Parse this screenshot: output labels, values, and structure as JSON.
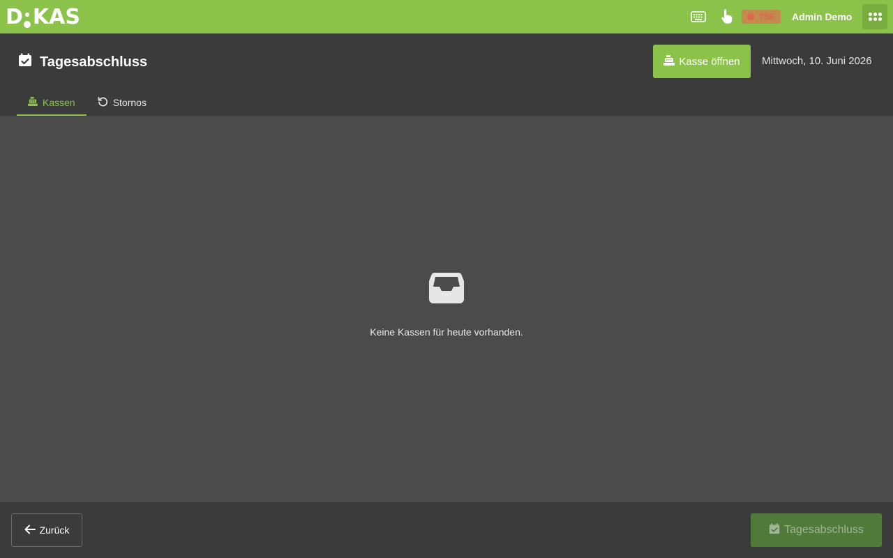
{
  "app": {
    "logo_text_1": "D",
    "logo_text_2": "KAS"
  },
  "topbar": {
    "keyboard_icon": "keyboard-icon",
    "touch_icon": "touch-hand-icon",
    "tse_label": "TSE",
    "user_name": "Admin Demo",
    "apps_icon": "apps-grid-icon"
  },
  "header": {
    "title": "Tagesabschluss",
    "open_button_label": "Kasse öffnen",
    "date": "Mittwoch, 10. Juni 2026"
  },
  "tabs": [
    {
      "label": "Kassen",
      "icon": "cash-register-icon",
      "active": true
    },
    {
      "label": "Stornos",
      "icon": "undo-icon",
      "active": false
    }
  ],
  "content": {
    "empty_icon": "inbox-icon",
    "empty_message": "Keine Kassen für heute vorhanden."
  },
  "footer": {
    "back_label": "Zurück",
    "close_label": "Tagesabschluss"
  },
  "colors": {
    "brand_green": "#8bc34a",
    "header_bg": "#3b3b3b",
    "content_bg": "#4b4b4b",
    "disabled_green": "#4f7a3a"
  }
}
